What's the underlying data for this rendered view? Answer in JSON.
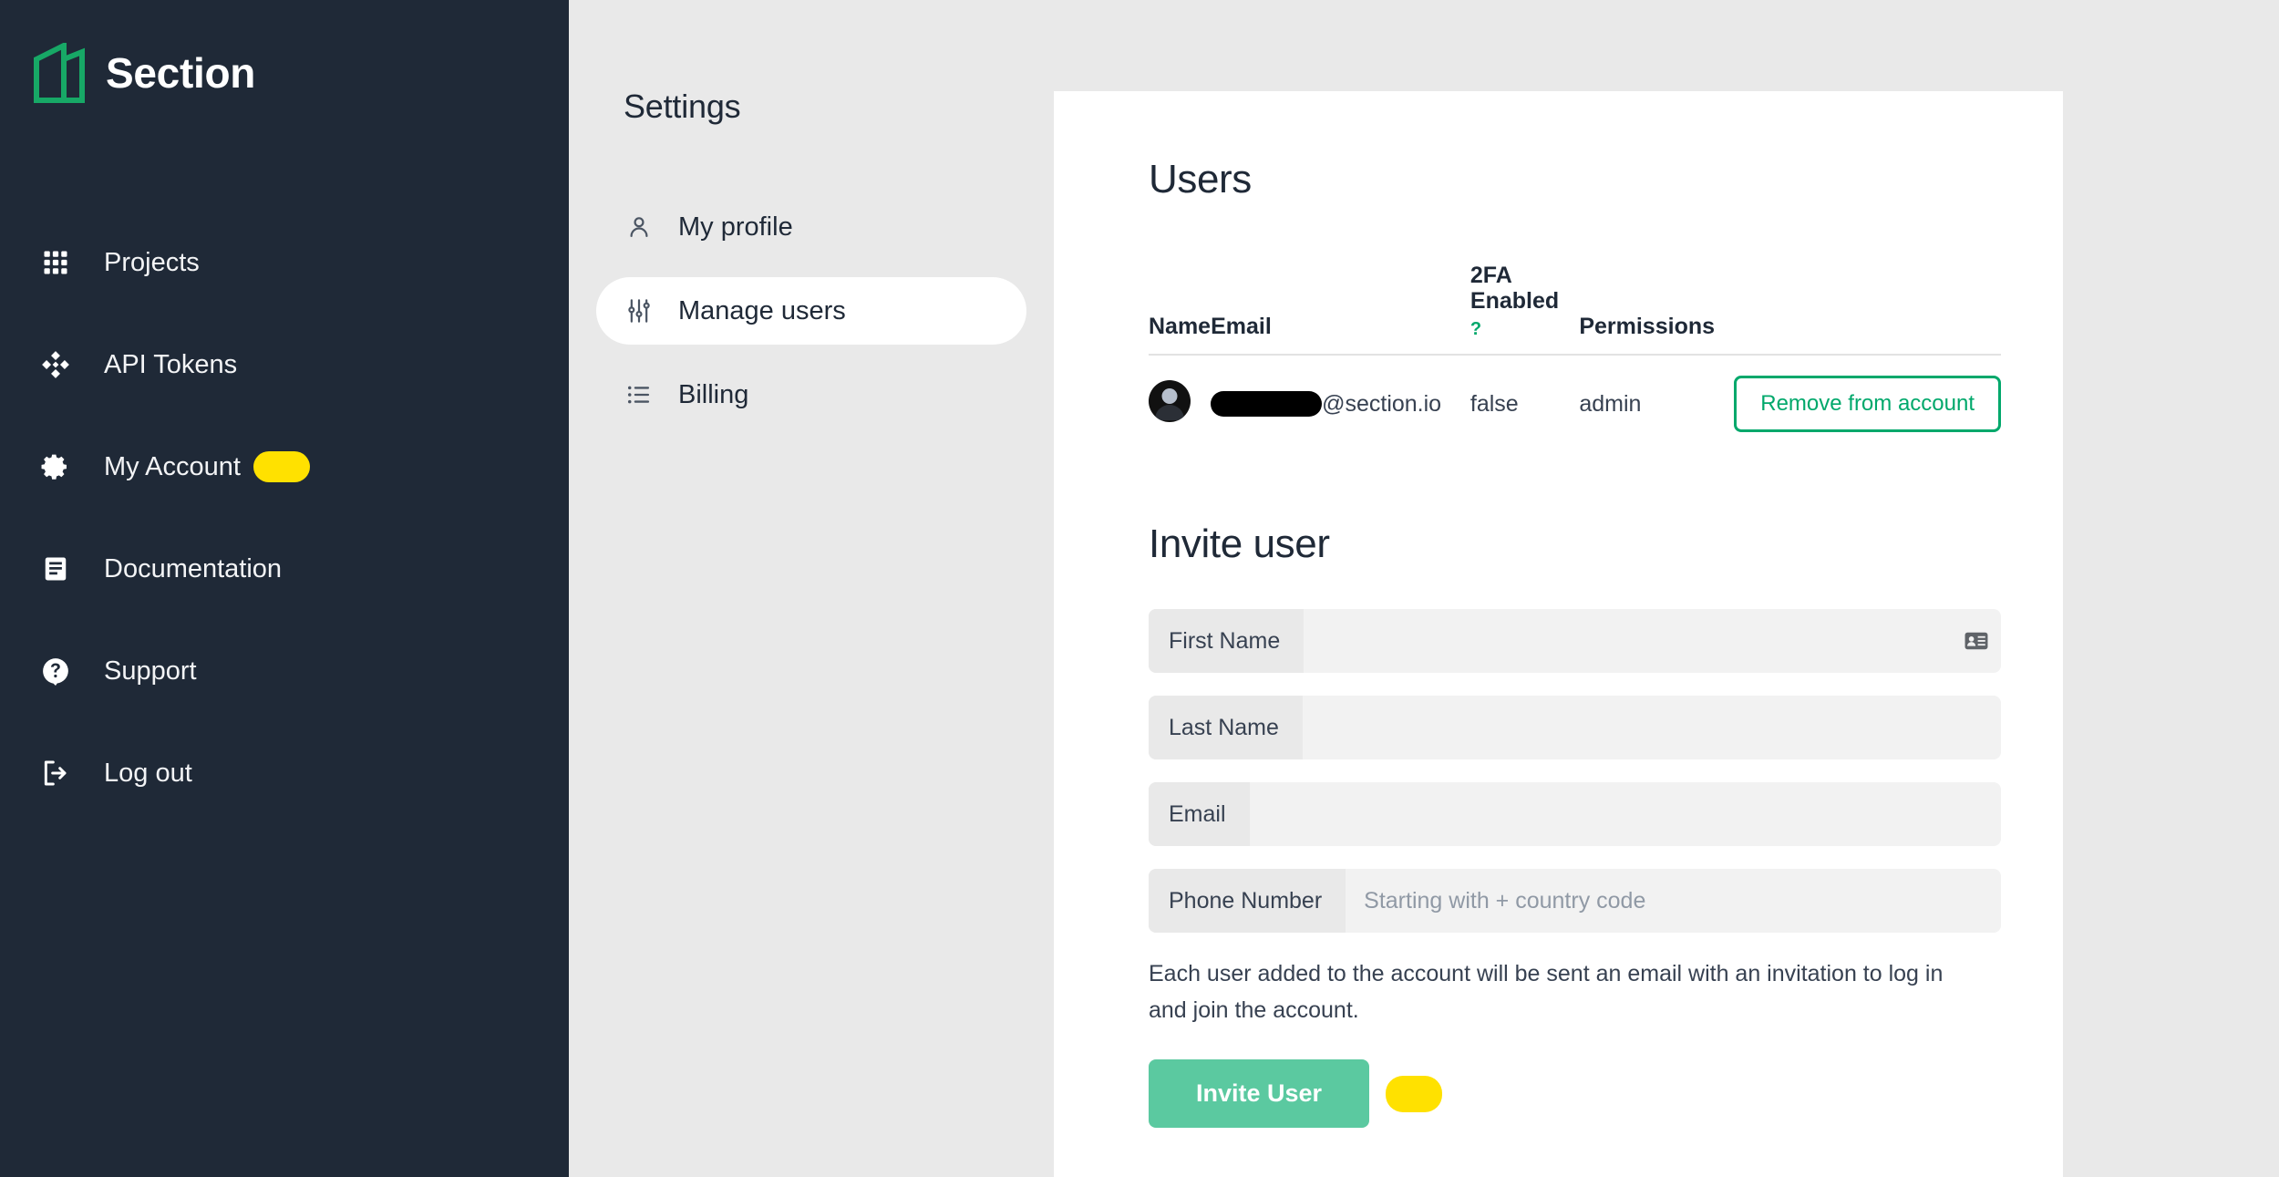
{
  "brand": {
    "name": "Section",
    "logo_icon": "section-logo-icon",
    "logo_color": "#17a866"
  },
  "sidebar": {
    "items": [
      {
        "label": "Projects",
        "icon": "grid-icon",
        "highlight": false
      },
      {
        "label": "API Tokens",
        "icon": "diamond-arrows-icon",
        "highlight": false
      },
      {
        "label": "My Account",
        "icon": "gear-icon",
        "highlight": true
      },
      {
        "label": "Documentation",
        "icon": "document-icon",
        "highlight": false
      },
      {
        "label": "Support",
        "icon": "question-help-icon",
        "highlight": false
      },
      {
        "label": "Log out",
        "icon": "logout-icon",
        "highlight": false
      }
    ],
    "highlight_color": "#ffe100",
    "background_color": "#1f2937"
  },
  "settings": {
    "title": "Settings",
    "items": [
      {
        "label": "My profile",
        "icon": "person-icon",
        "active": false
      },
      {
        "label": "Manage users",
        "icon": "sliders-icon",
        "active": true
      },
      {
        "label": "Billing",
        "icon": "list-icon",
        "active": false
      }
    ]
  },
  "users_section": {
    "title": "Users",
    "columns": {
      "name": "Name",
      "email": "Email",
      "twofa_line1": "2FA",
      "twofa_line2": "Enabled",
      "twofa_help": "?",
      "permissions": "Permissions"
    },
    "rows": [
      {
        "avatar": "user-avatar",
        "name_redacted": true,
        "email_domain": "@section.io",
        "twofa_enabled": "false",
        "permissions": "admin",
        "remove_label": "Remove from account"
      }
    ],
    "accent_color": "#00a86b"
  },
  "invite_section": {
    "title": "Invite user",
    "fields": [
      {
        "label": "First Name",
        "value": "",
        "placeholder": "",
        "icon": "contact-card-icon"
      },
      {
        "label": "Last Name",
        "value": "",
        "placeholder": "",
        "icon": ""
      },
      {
        "label": "Email",
        "value": "",
        "placeholder": "",
        "icon": ""
      },
      {
        "label": "Phone Number",
        "value": "",
        "placeholder": "Starting with + country code",
        "icon": ""
      }
    ],
    "note": "Each user added to the account will be sent an email with an invitation to log in and join the account.",
    "submit_label": "Invite User",
    "submit_color": "#5bc9a0",
    "highlight_color": "#ffe100"
  }
}
